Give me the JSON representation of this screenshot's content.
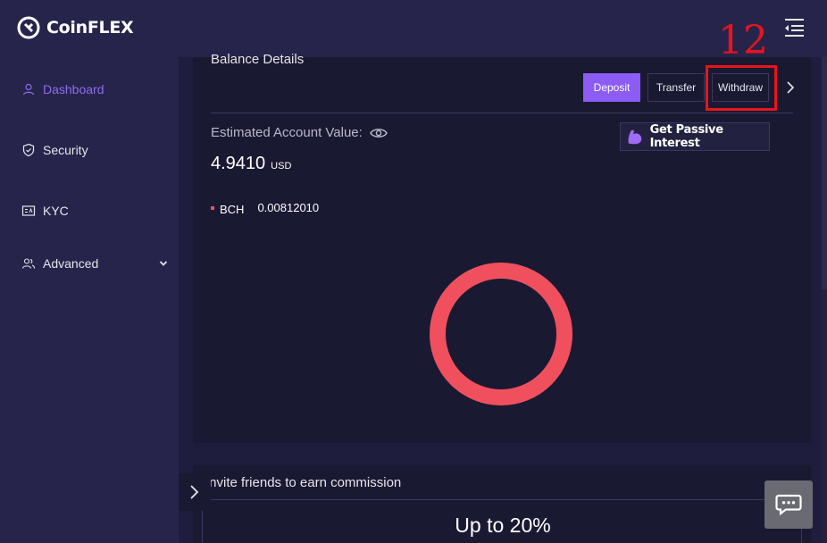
{
  "header": {
    "logo_text": "CoinFLEX",
    "menu_icon": "collapse-menu-icon"
  },
  "sidebar": {
    "items": [
      {
        "label": "Dashboard",
        "icon": "user-icon",
        "active": true
      },
      {
        "label": "Security",
        "icon": "shield-icon"
      },
      {
        "label": "KYC",
        "icon": "id-card-icon"
      },
      {
        "label": "Advanced",
        "icon": "users-icon",
        "expandable": true
      }
    ]
  },
  "balance": {
    "title": "Balance Details",
    "deposit_label": "Deposit",
    "transfer_label": "Transfer",
    "withdraw_label": "Withdraw",
    "estimated_label": "Estimated Account Value:",
    "estimated_value": "4.9410",
    "currency": "USD",
    "passive_label": "Get Passive Interest",
    "assets": [
      {
        "asset": "BCH",
        "amount": "0.00812010",
        "color": "#f0505e"
      }
    ]
  },
  "annotation": {
    "label": "12",
    "color": "#e8141c"
  },
  "invite": {
    "title": "Invite friends to earn commission",
    "highlight": "Up to 20%"
  },
  "colors": {
    "accent": "#8c5cf5",
    "bch": "#f0505e"
  }
}
